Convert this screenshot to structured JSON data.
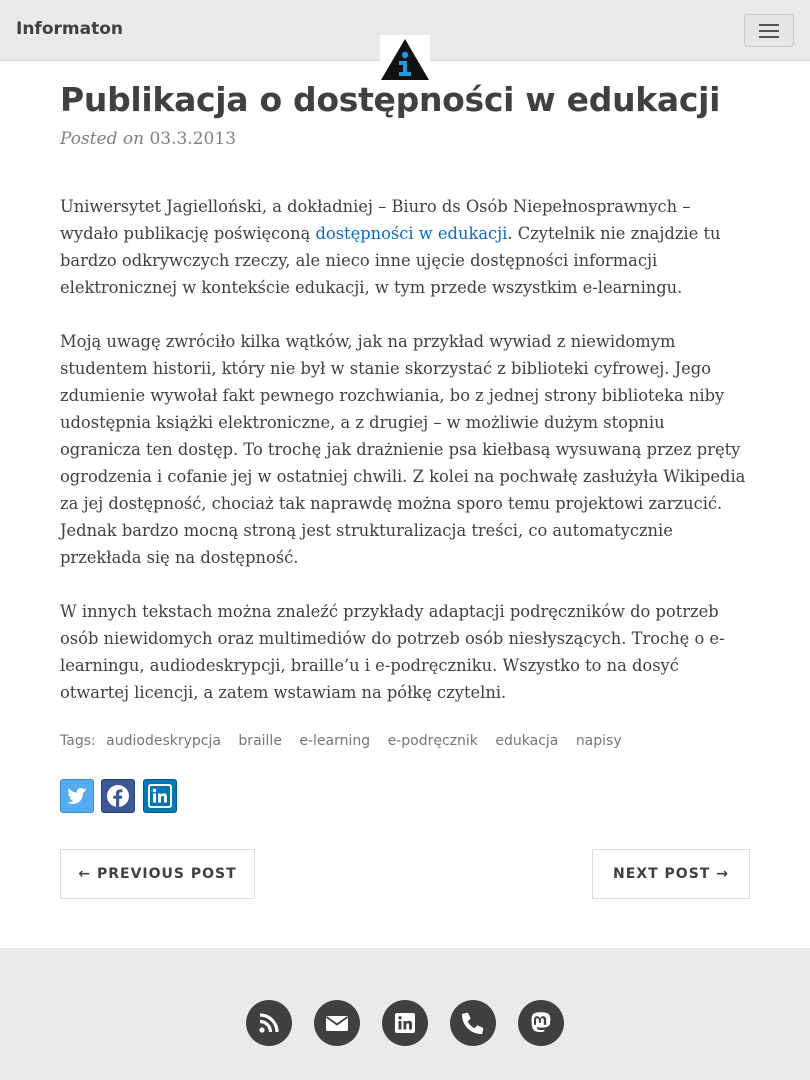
{
  "navbar": {
    "brand": "Informaton",
    "menu_icon": "hamburger-menu-icon",
    "logo_icon": "info-triangle-logo"
  },
  "post": {
    "title": "Publikacja o dostępności w edukacji",
    "meta_prefix": "Posted on",
    "date": "03.3.2013",
    "paragraph1_before": "Uniwersytet Jagielloński, a dokładniej – Biuro ds Osób Niepełnosprawnych – wydało publikację poświęconą ",
    "paragraph1_link": "dostępności w edukacji",
    "paragraph1_after": ". Czytelnik nie znajdzie tu bardzo odkrywczych rzeczy, ale nieco inne ujęcie dostępności informacji elektronicznej w kontekście edukacji, w tym przede wszystkim e-learningu.",
    "paragraph2": "Moją uwagę zwróciło kilka wątków, jak na przykład wywiad z niewidomym studentem historii, który nie był w stanie skorzystać z biblioteki cyfrowej. Jego zdumienie wywołał fakt pewnego rozchwiania, bo z jednej strony biblioteka niby udostępnia książki elektroniczne, a z drugiej – w możliwie dużym stopniu ogranicza ten dostęp. To trochę jak drażnienie psa kiełbasą wysuwaną przez pręty ogrodzenia i cofanie jej w ostatniej chwili. Z kolei na pochwałę zasłużyła Wikipedia za jej dostępność, chociaż tak naprawdę można sporo temu projektowi zarzucić. Jednak bardzo mocną stroną jest strukturalizacja treści, co automatycznie przekłada się na dostępność.",
    "paragraph3": "W innych tekstach można znaleźć przykłady adaptacji podręczników do potrzeb osób niewidomych oraz multimediów do potrzeb osób niesłyszących. Trochę o e-learningu, audiodeskrypcji, braille’u i e-podręczniku. Wszystko to na dosyć otwartej licencji, a zatem wstawiam na półkę czytelni.",
    "tags_label": "Tags:",
    "tags": [
      "audiodeskrypcja",
      "braille",
      "e-learning",
      "e-podręcznik",
      "edukacja",
      "napisy"
    ]
  },
  "share": {
    "icons": [
      "twitter-icon",
      "facebook-icon",
      "linkedin-icon"
    ],
    "colors": {
      "twitter": "#55acee",
      "facebook": "#3b5998",
      "linkedin": "#0077b5"
    }
  },
  "pager": {
    "previous": "← PREVIOUS POST",
    "next": "NEXT POST →"
  },
  "footer": {
    "icons": [
      "rss-icon",
      "envelope-icon",
      "linkedin-icon",
      "phone-icon",
      "mastodon-icon"
    ]
  }
}
